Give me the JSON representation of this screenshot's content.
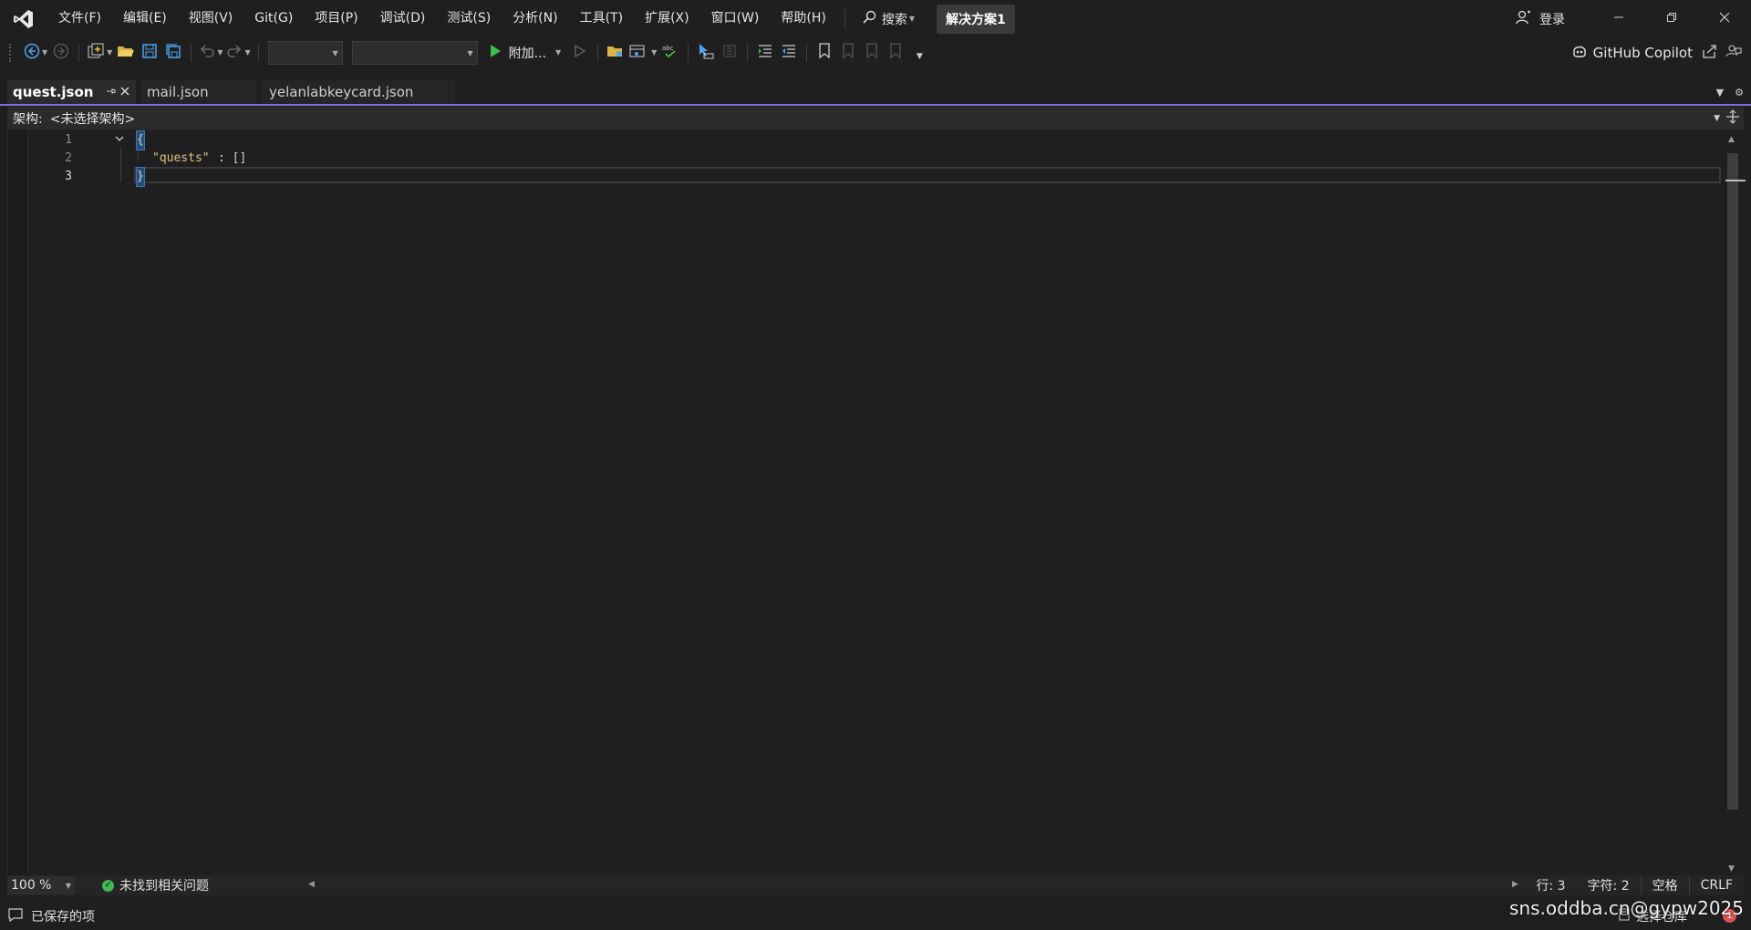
{
  "menu": {
    "items": [
      "文件(F)",
      "编辑(E)",
      "视图(V)",
      "Git(G)",
      "项目(P)",
      "调试(D)",
      "测试(S)",
      "分析(N)",
      "工具(T)",
      "扩展(X)",
      "窗口(W)",
      "帮助(H)"
    ],
    "search_label": "搜索",
    "solution_name": "解决方案1",
    "login_label": "登录"
  },
  "toolbar": {
    "run_label": "附加...",
    "copilot_label": "GitHub Copilot"
  },
  "tabs": [
    {
      "label": "quest.json",
      "active": true
    },
    {
      "label": "mail.json",
      "active": false
    },
    {
      "label": "yelanlabkeycard.json",
      "active": false
    }
  ],
  "schema": {
    "label": "架构:",
    "value": "<未选择架构>"
  },
  "editor": {
    "lines": [
      {
        "number": "1",
        "text": "{"
      },
      {
        "number": "2",
        "key": "\"quests\"",
        "rest": ": []"
      },
      {
        "number": "3",
        "text": "}"
      }
    ]
  },
  "editor_status": {
    "zoom": "100 %",
    "issues": "未找到相关问题",
    "line": "行: 3",
    "char": "字符: 2",
    "whitespace": "空格",
    "eol": "CRLF"
  },
  "status": {
    "saved": "已保存的项",
    "right_label": "选择仓库",
    "notifications": "1"
  },
  "watermark": "sns.oddba.cn@gypw2025",
  "colors": {
    "accent": "#7a6ee0",
    "background": "#1f1f1f",
    "key": "#e0c08a",
    "ok": "#3fb950"
  }
}
